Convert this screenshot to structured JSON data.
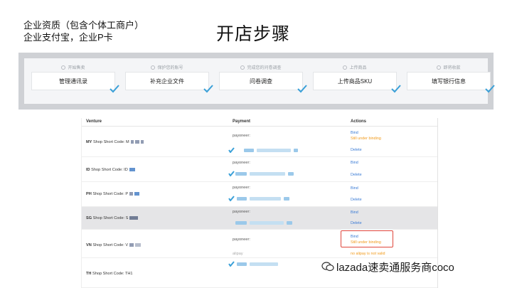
{
  "notes": {
    "line1": "企业资质（包含个体工商户）",
    "line2": "企业支付宝，企业P卡"
  },
  "title": "开店步骤",
  "steps": [
    {
      "caption": "开始售卖",
      "label": "管理通讯录"
    },
    {
      "caption": "保护您的账号",
      "label": "补充企业文件"
    },
    {
      "caption": "完成您的问卷调查",
      "label": "问卷调查"
    },
    {
      "caption": "上传商品",
      "label": "上传商品SKU"
    },
    {
      "caption": "即将收款",
      "label": "填写银行信息"
    }
  ],
  "table": {
    "headers": {
      "venture": "Venture",
      "payment": "Payment",
      "actions": "Actions"
    },
    "rows": [
      {
        "code": "MY",
        "label": "Shop Short Code: M",
        "payment": "payoneer:",
        "action1": "Bind",
        "action1_status": "Still under binding",
        "action2": "Delete"
      },
      {
        "code": "ID",
        "label": "Shop Short Code: ID",
        "payment": "payoneer:",
        "action1": "Bind",
        "action2": "Delete"
      },
      {
        "code": "PH",
        "label": "Shop Short Code: P",
        "payment": "payoneer:",
        "action1": "Bind",
        "action2": "Delete"
      },
      {
        "code": "SG",
        "label": "Shop Short Code: S",
        "payment": "payoneer:",
        "action1": "Bind",
        "action2": "Delete"
      },
      {
        "code": "VN",
        "label": "Shop Short Code: V",
        "payment": "payoneer:",
        "action1": "Bind",
        "action1_status": "Still under binding",
        "alt_payment": "alipay",
        "alt_status": "no alipay is not valid"
      },
      {
        "code": "TH",
        "label": "Shop Short Code: TH1"
      }
    ]
  },
  "watermark": "lazada速卖通服务商coco",
  "colors": {
    "link": "#3a7bd5",
    "warning": "#f19a1b",
    "check": "#3aa0d8",
    "highlight_border": "#e0463c"
  }
}
